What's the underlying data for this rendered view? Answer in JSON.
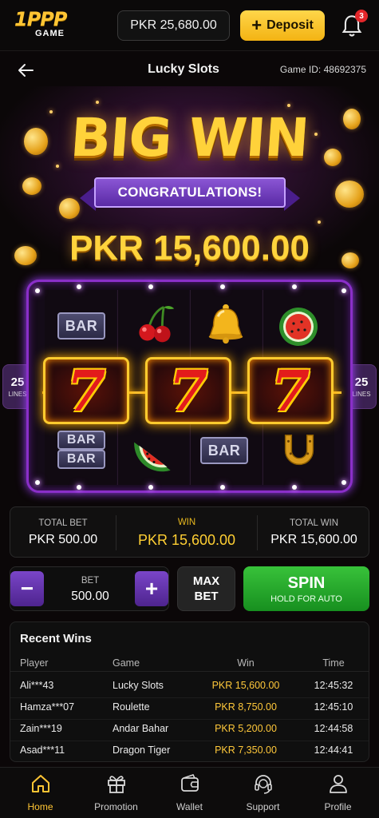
{
  "header": {
    "logo_main": "1PPP",
    "logo_sub": "GAME",
    "balance": "PKR 25,680.00",
    "deposit_label": "Deposit",
    "notification_count": "3"
  },
  "game": {
    "title": "Lucky Slots",
    "game_id": "Game ID: 48692375"
  },
  "hero": {
    "headline": "BIG WIN",
    "ribbon": "CONGRATULATIONS!",
    "prize": "PKR 15,600.00"
  },
  "reels": {
    "lines_count": "25",
    "lines_label": "LINES",
    "top_row": [
      "BAR",
      "cherry",
      "bell",
      "watermelon"
    ],
    "middle_row": [
      "7",
      "7",
      "7"
    ],
    "bottom_row": [
      "BAR BAR",
      "watermelon-slice",
      "BAR",
      "horseshoe"
    ],
    "bar_text": "BAR"
  },
  "summary": {
    "total_bet_label": "TOTAL BET",
    "total_bet_value": "PKR 500.00",
    "win_label": "WIN",
    "win_value": "PKR 15,600.00",
    "total_win_label": "TOTAL WIN",
    "total_win_value": "PKR 15,600.00"
  },
  "controls": {
    "minus": "−",
    "plus": "+",
    "bet_label": "BET",
    "bet_value": "500.00",
    "max_line1": "MAX",
    "max_line2": "BET",
    "spin_label": "SPIN",
    "spin_sub": "HOLD FOR AUTO"
  },
  "recent_wins": {
    "title": "Recent Wins",
    "columns": [
      "Player",
      "Game",
      "Win",
      "Time"
    ],
    "rows": [
      {
        "player": "Ali***43",
        "game": "Lucky Slots",
        "win": "PKR 15,600.00",
        "time": "12:45:32"
      },
      {
        "player": "Hamza***07",
        "game": "Roulette",
        "win": "PKR 8,750.00",
        "time": "12:45:10"
      },
      {
        "player": "Zain***19",
        "game": "Andar Bahar",
        "win": "PKR 5,200.00",
        "time": "12:44:58"
      },
      {
        "player": "Asad***11",
        "game": "Dragon Tiger",
        "win": "PKR 7,350.00",
        "time": "12:44:41"
      }
    ]
  },
  "nav": {
    "items": [
      {
        "label": "Home",
        "icon": "home-icon"
      },
      {
        "label": "Promotion",
        "icon": "gift-icon"
      },
      {
        "label": "Wallet",
        "icon": "wallet-icon"
      },
      {
        "label": "Support",
        "icon": "headset-icon"
      },
      {
        "label": "Profile",
        "icon": "user-icon"
      }
    ],
    "active": "Home"
  },
  "colors": {
    "accent_gold": "#ffc534",
    "accent_purple": "#8a2fc8",
    "spin_green": "#2fb233",
    "background": "#0b0708"
  }
}
